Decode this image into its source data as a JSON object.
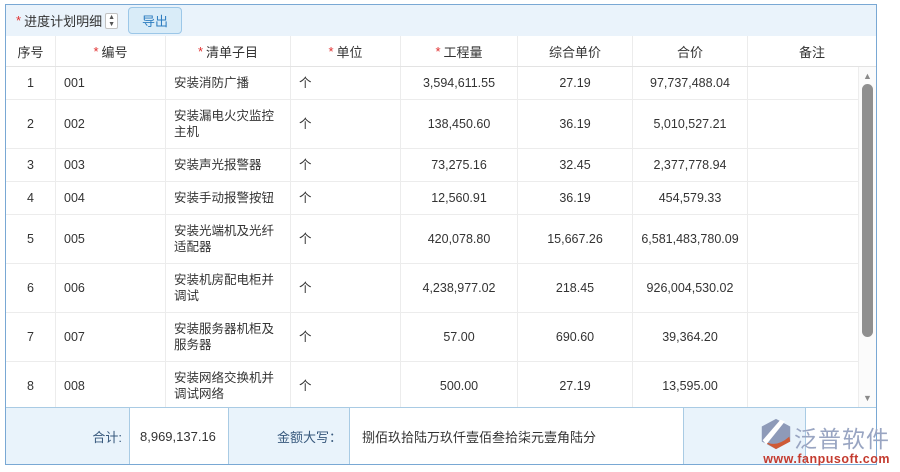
{
  "toolbar": {
    "required_mark": "*",
    "title": "进度计划明细",
    "spinner_up": "▲",
    "spinner_down": "▼",
    "export_label": "导出"
  },
  "table": {
    "columns": [
      {
        "label": "序号",
        "required": false
      },
      {
        "label": "编号",
        "required": true
      },
      {
        "label": "清单子目",
        "required": true
      },
      {
        "label": "单位",
        "required": true
      },
      {
        "label": "工程量",
        "required": true
      },
      {
        "label": "综合单价",
        "required": false
      },
      {
        "label": "合价",
        "required": false
      },
      {
        "label": "备注",
        "required": false
      }
    ],
    "rows": [
      {
        "seq": "1",
        "code": "001",
        "item": "安装消防广播",
        "unit": "个",
        "quantity": "3,594,611.55",
        "unit_price": "27.19",
        "total": "97,737,488.04",
        "remark": ""
      },
      {
        "seq": "2",
        "code": "002",
        "item": "安装漏电火灾监控主机",
        "unit": "个",
        "quantity": "138,450.60",
        "unit_price": "36.19",
        "total": "5,010,527.21",
        "remark": ""
      },
      {
        "seq": "3",
        "code": "003",
        "item": "安装声光报警器",
        "unit": "个",
        "quantity": "73,275.16",
        "unit_price": "32.45",
        "total": "2,377,778.94",
        "remark": ""
      },
      {
        "seq": "4",
        "code": "004",
        "item": "安装手动报警按钮",
        "unit": "个",
        "quantity": "12,560.91",
        "unit_price": "36.19",
        "total": "454,579.33",
        "remark": ""
      },
      {
        "seq": "5",
        "code": "005",
        "item": "安装光端机及光纤适配器",
        "unit": "个",
        "quantity": "420,078.80",
        "unit_price": "15,667.26",
        "total": "6,581,483,780.09",
        "remark": ""
      },
      {
        "seq": "6",
        "code": "006",
        "item": "安装机房配电柜并调试",
        "unit": "个",
        "quantity": "4,238,977.02",
        "unit_price": "218.45",
        "total": "926,004,530.02",
        "remark": ""
      },
      {
        "seq": "7",
        "code": "007",
        "item": "安装服务器机柜及服务器",
        "unit": "个",
        "quantity": "57.00",
        "unit_price": "690.60",
        "total": "39,364.20",
        "remark": ""
      },
      {
        "seq": "8",
        "code": "008",
        "item": "安装网络交换机并调试网络",
        "unit": "个",
        "quantity": "500.00",
        "unit_price": "27.19",
        "total": "13,595.00",
        "remark": ""
      }
    ]
  },
  "footer": {
    "total_label": "合计:",
    "total_value": "8,969,137.16",
    "capital_label": "金额大写：",
    "capital_value": "捌佰玖拾陆万玖仟壹佰叁拾柒元壹角陆分"
  },
  "scrollbar": {
    "up_glyph": "▲",
    "down_glyph": "▼"
  },
  "watermark": {
    "brand": "泛普软件",
    "url": "www.fanpusoft.com"
  },
  "colors": {
    "accent_blue": "#2d7dc0",
    "container_border": "#79a8d4",
    "toolbar_bg": "#eaf3fb",
    "footer_bg": "#e9f3fb",
    "footer_border": "#a9cbe4",
    "required_red": "#e02f2f",
    "watermark_brand": "#99a5c2",
    "watermark_red": "#c43b2f",
    "scroll_thumb": "#8f8f8f"
  }
}
